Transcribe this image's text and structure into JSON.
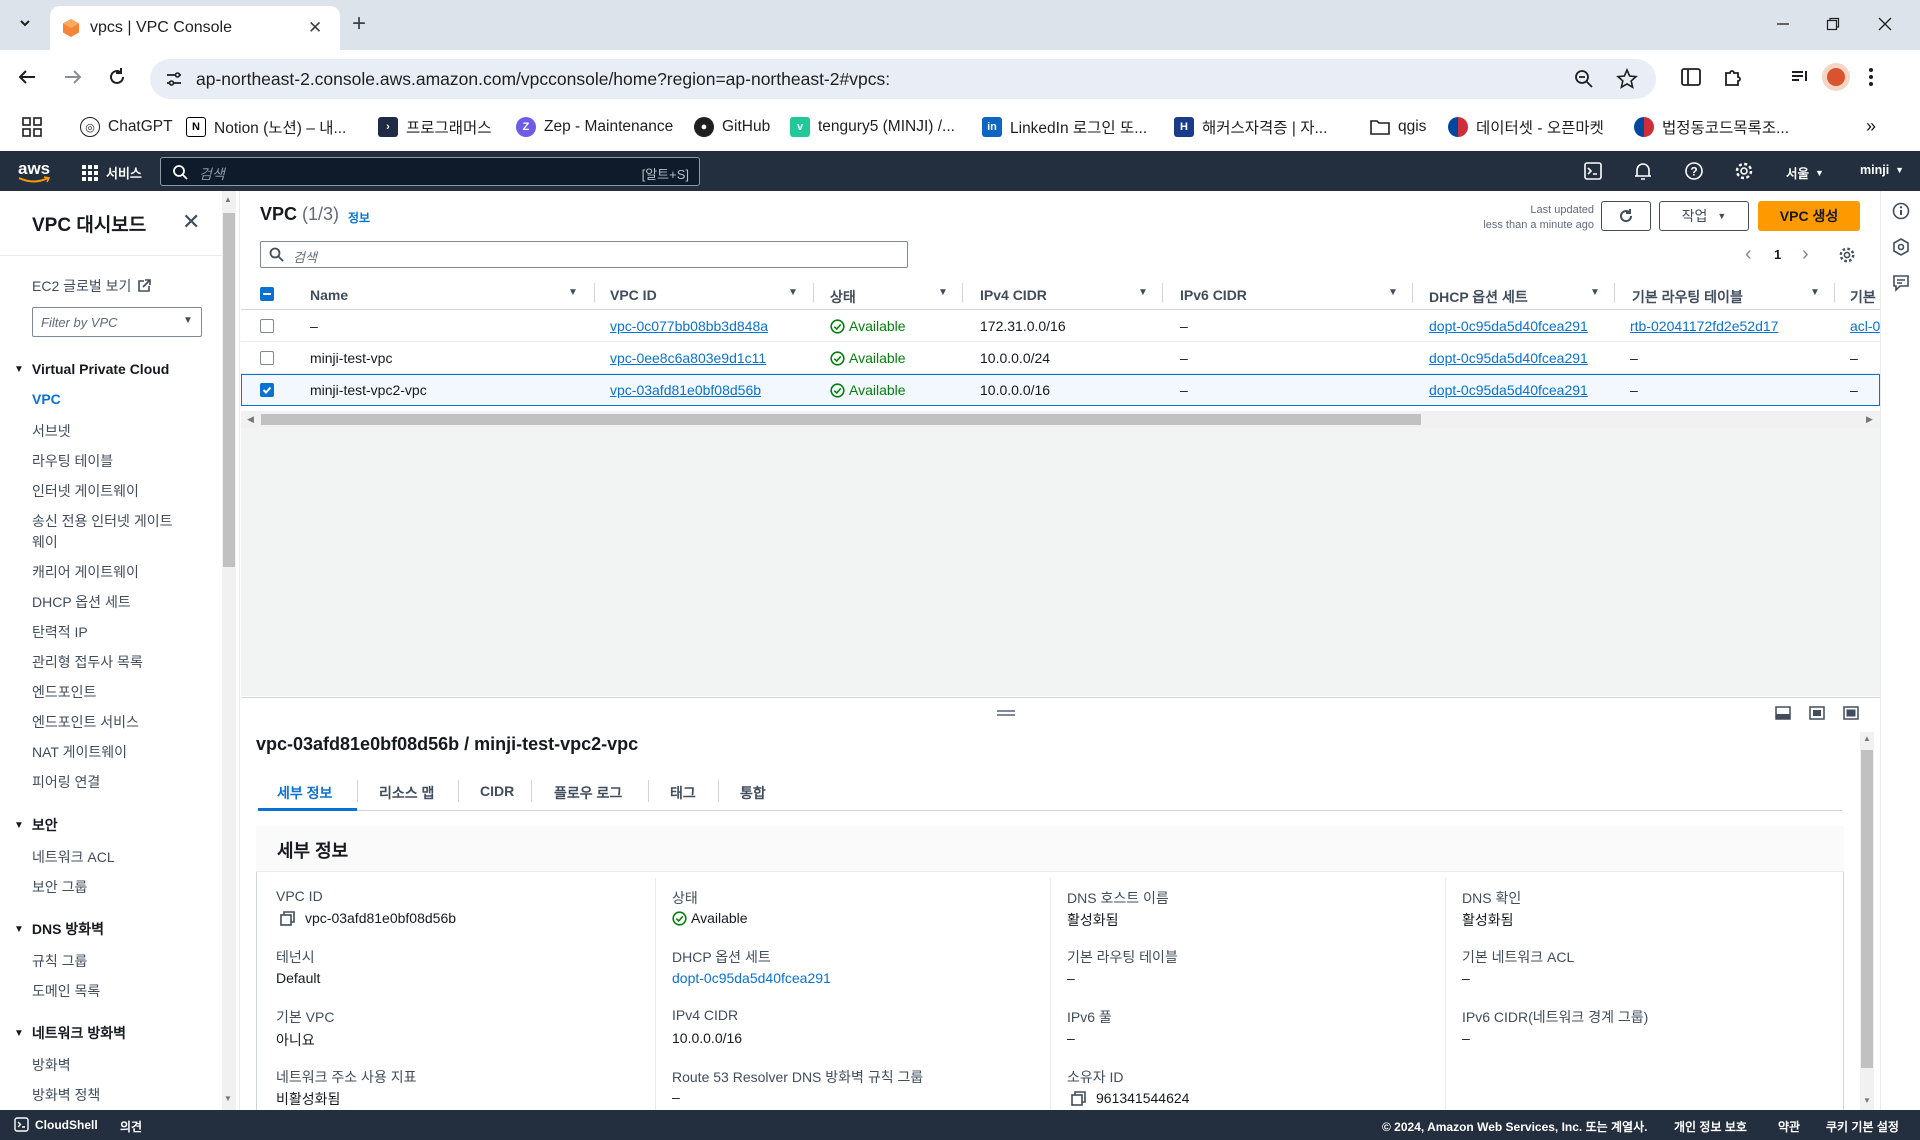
{
  "browser": {
    "tab_title": "vpcs | VPC Console",
    "url": "ap-northeast-2.console.aws.amazon.com/vpcconsole/home?region=ap-northeast-2#vpcs:",
    "bookmarks": [
      {
        "label": "ChatGPT",
        "icon": "chatgpt-icon",
        "color": "#1f1f1f"
      },
      {
        "label": "Notion (노션) – 내...",
        "icon": "notion-icon",
        "color": "#1f1f1f"
      },
      {
        "label": "프로그래머스",
        "icon": "programmers-icon",
        "color": "#1f2a44"
      },
      {
        "label": "Zep - Maintenance",
        "icon": "zep-icon",
        "color": "#6c5ce7"
      },
      {
        "label": "GitHub",
        "icon": "github-icon",
        "color": "#1f1f1f"
      },
      {
        "label": "tengury5 (MINJI) /...",
        "icon": "velog-icon",
        "color": "#20c997"
      },
      {
        "label": "LinkedIn 로그인 또...",
        "icon": "linkedin-icon",
        "color": "#0a66c2"
      },
      {
        "label": "해커스자격증 | 자...",
        "icon": "hackers-icon",
        "color": "#1a3a8a"
      },
      {
        "label": "qgis",
        "icon": "folder-icon",
        "color": "#1f1f1f"
      },
      {
        "label": "데이터셋 - 오픈마켓",
        "icon": "korea-flag-icon",
        "color": "#cd2e3a"
      },
      {
        "label": "법정동코드목록조...",
        "icon": "korea-flag-icon",
        "color": "#cd2e3a"
      }
    ]
  },
  "aws": {
    "logo": "aws",
    "services": "서비스",
    "search_placeholder": "검색",
    "search_shortcut": "[알트+S]",
    "region": "서울",
    "user": "minji"
  },
  "sidebar": {
    "title": "VPC 대시보드",
    "ec2_global": "EC2 글로벌 보기",
    "filter_placeholder": "Filter by VPC",
    "sections": [
      {
        "title": "Virtual Private Cloud",
        "items": [
          "VPC",
          "서브넷",
          "라우팅 테이블",
          "인터넷 게이트웨이",
          "송신 전용 인터넷 게이트",
          "웨이",
          "캐리어 게이트웨이",
          "DHCP 옵션 세트",
          "탄력적 IP",
          "관리형 접두사 목록",
          "엔드포인트",
          "엔드포인트 서비스",
          "NAT 게이트웨이",
          "피어링 연결"
        ]
      },
      {
        "title": "보안",
        "items": [
          "네트워크 ACL",
          "보안 그룹"
        ]
      },
      {
        "title": "DNS 방화벽",
        "items": [
          "규칙 그룹",
          "도메인 목록"
        ]
      },
      {
        "title": "네트워크 방화벽",
        "items": [
          "방화벽",
          "방화벽 정책"
        ]
      }
    ]
  },
  "table": {
    "title": "VPC",
    "count": "(1/3)",
    "info": "정보",
    "last_updated_label": "Last updated",
    "last_updated_value": "less than a minute ago",
    "actions_label": "작업",
    "create_label": "VPC 생성",
    "search_placeholder": "검색",
    "page": "1",
    "columns": [
      "Name",
      "VPC ID",
      "상태",
      "IPv4 CIDR",
      "IPv6 CIDR",
      "DHCP 옵션 세트",
      "기본 라우팅 테이블",
      "기본"
    ],
    "rows": [
      {
        "checked": false,
        "name": "–",
        "vpc_id": "vpc-0c077bb08bb3d848a",
        "state": "Available",
        "ipv4": "172.31.0.0/16",
        "ipv6": "–",
        "dhcp": "dopt-0c95da5d40fcea291",
        "rt": "rtb-02041172fd2e52d17",
        "acl": "acl-0"
      },
      {
        "checked": false,
        "name": "minji-test-vpc",
        "vpc_id": "vpc-0ee8c6a803e9d1c11",
        "state": "Available",
        "ipv4": "10.0.0.0/24",
        "ipv6": "–",
        "dhcp": "dopt-0c95da5d40fcea291",
        "rt": "–",
        "acl": "–"
      },
      {
        "checked": true,
        "name": "minji-test-vpc2-vpc",
        "vpc_id": "vpc-03afd81e0bf08d56b",
        "state": "Available",
        "ipv4": "10.0.0.0/16",
        "ipv6": "–",
        "dhcp": "dopt-0c95da5d40fcea291",
        "rt": "–",
        "acl": "–"
      }
    ]
  },
  "detail": {
    "heading": "vpc-03afd81e0bf08d56b / minji-test-vpc2-vpc",
    "tabs": [
      "세부 정보",
      "리소스 맵",
      "CIDR",
      "플로우 로그",
      "태그",
      "통합"
    ],
    "section_title": "세부 정보",
    "fields": {
      "vpc_id_label": "VPC ID",
      "vpc_id": "vpc-03afd81e0bf08d56b",
      "state_label": "상태",
      "state": "Available",
      "dns_host_label": "DNS 호스트 이름",
      "dns_host": "활성화됨",
      "dns_res_label": "DNS 확인",
      "dns_res": "활성화됨",
      "tenancy_label": "테넌시",
      "tenancy": "Default",
      "dhcp_label": "DHCP 옵션 세트",
      "dhcp": "dopt-0c95da5d40fcea291",
      "rt_label": "기본 라우팅 테이블",
      "rt": "–",
      "acl_label": "기본 네트워크 ACL",
      "acl": "–",
      "default_vpc_label": "기본 VPC",
      "default_vpc": "아니요",
      "ipv4_label": "IPv4 CIDR",
      "ipv4": "10.0.0.0/16",
      "ipv6_pool_label": "IPv6 풀",
      "ipv6_pool": "–",
      "ipv6_cidr_label": "IPv6 CIDR(네트워크 경계 그룹)",
      "ipv6_cidr": "–",
      "nau_label": "네트워크 주소 사용 지표",
      "nau": "비활성화됨",
      "r53_label": "Route 53 Resolver DNS 방화벽 규칙 그룹",
      "r53": "–",
      "owner_label": "소유자 ID",
      "owner": "961341544624"
    }
  },
  "footer": {
    "cloudshell": "CloudShell",
    "feedback": "의견",
    "copyright": "© 2024, Amazon Web Services, Inc. 또는 계열사.",
    "privacy": "개인 정보 보호",
    "terms": "약관",
    "cookies": "쿠키 기본 설정"
  },
  "colors": {
    "aws_nav": "#232f3e",
    "accent_link": "#0972d3",
    "success": "#037f0c",
    "primary_button": "#ff9900"
  }
}
